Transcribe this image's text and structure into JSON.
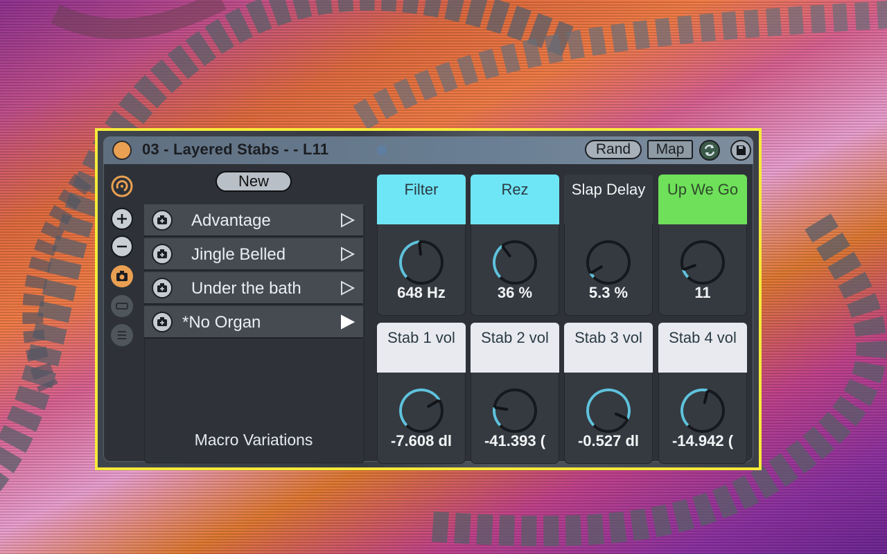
{
  "device": {
    "title": "03 - Layered Stabs - - L11",
    "rand_label": "Rand",
    "map_label": "Map",
    "border_color": "#f6ea3a"
  },
  "toolbar": {
    "icons": [
      "hotswap-icon",
      "add-icon",
      "remove-icon",
      "camera-icon",
      "collapse-icon",
      "list-icon"
    ]
  },
  "variations": {
    "new_label": "New",
    "items": [
      {
        "label": "Advantage"
      },
      {
        "label": "Jingle Belled"
      },
      {
        "label": "Under the bath"
      },
      {
        "label": "*No Organ"
      }
    ],
    "title": "Macro Variations"
  },
  "macros": [
    {
      "name": "Filter",
      "value": "648 Hz",
      "level": 0.48,
      "color": "#6fe6f5"
    },
    {
      "name": "Rez",
      "value": "36 %",
      "level": 0.36,
      "color": "#6fe6f5"
    },
    {
      "name": "Slap Delay",
      "value": "5.3 %",
      "level": 0.05,
      "color": "#353a40"
    },
    {
      "name": "Up We Go",
      "value": "11",
      "level": 0.09,
      "color": "#6ee05a"
    },
    {
      "name": "Stab 1 vol",
      "value": "-7.608 dl",
      "level": 0.72,
      "color": "#e8eaf0"
    },
    {
      "name": "Stab 2 vol",
      "value": "-41.393 (",
      "level": 0.2,
      "color": "#e8eaf0"
    },
    {
      "name": "Stab 3 vol",
      "value": "-0.527 dl",
      "level": 0.92,
      "color": "#e8eaf0"
    },
    {
      "name": "Stab 4 vol",
      "value": "-14.942 (",
      "level": 0.55,
      "color": "#e8eaf0"
    }
  ],
  "colors": {
    "accent_orange": "#eaa052",
    "accent_cyan": "#6fe6f5",
    "accent_green": "#6ee05a"
  }
}
